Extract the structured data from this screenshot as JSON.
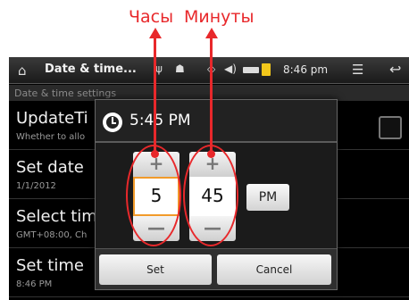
{
  "annotations": {
    "hours": "Часы",
    "minutes": "Минуты"
  },
  "actionbar": {
    "title": "Date & time...",
    "time": "8:46 pm",
    "home_icon": "home-icon",
    "usb_icon": "usb-icon",
    "android_icon": "android-debug-icon",
    "wifi_icon": "gps-icon",
    "volume_icon": "volume-icon",
    "battery_icon": "battery-icon",
    "menu_icon": "menu-icon",
    "back_icon": "back-arrow-icon"
  },
  "section_header": "Date & time settings",
  "preferences": [
    {
      "title": "UpdateTi",
      "summary": "Whether to allo"
    },
    {
      "title": "Set date",
      "summary": "1/1/2012"
    },
    {
      "title": "Select tim",
      "summary": "GMT+08:00, Ch"
    },
    {
      "title": "Set time",
      "summary": "8:46 PM"
    }
  ],
  "dialog": {
    "title": "5:45 PM",
    "hour": "5",
    "minute": "45",
    "ampm": "PM",
    "plus": "+",
    "minus": "—",
    "set_label": "Set",
    "cancel_label": "Cancel"
  },
  "colors": {
    "annotation": "#e8282b",
    "focus": "#f19a2a"
  }
}
